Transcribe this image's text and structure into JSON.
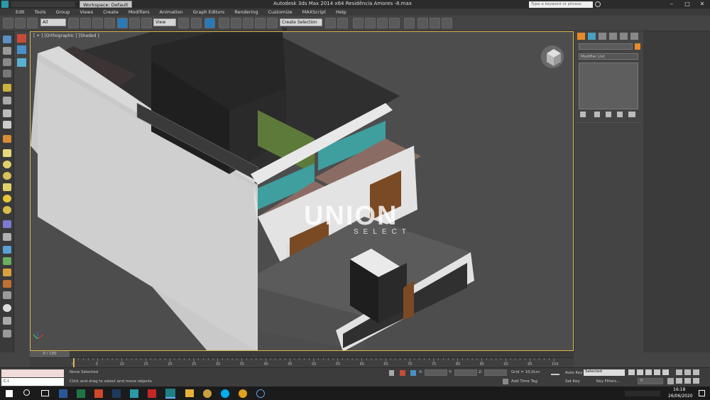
{
  "titlebar": {
    "workspace": "Workspace: Default",
    "title": "Autodesk 3ds Max  2014 x64     Residência Amores -8.max",
    "search_placeholder": "Type a keyword or phrase"
  },
  "menu": [
    "Edit",
    "Tools",
    "Group",
    "Views",
    "Create",
    "Modifiers",
    "Animation",
    "Graph Editors",
    "Rendering",
    "Customize",
    "MAXScript",
    "Help"
  ],
  "toolbar": {
    "filter": "All",
    "ref_coord": "View",
    "selection_set": "Create Selection Se"
  },
  "viewport": {
    "label": "[ + ] [Orthographic ] [Shaded ]",
    "watermark_main": "UNION",
    "watermark_sub": "SELECT"
  },
  "command_panel": {
    "modifier_list": "Modifier List",
    "accent": "#e88a2a"
  },
  "timeline": {
    "frame": "0 / 100",
    "ticks": [
      "0",
      "5",
      "10",
      "15",
      "20",
      "25",
      "30",
      "35",
      "40",
      "45",
      "50",
      "55",
      "60",
      "65",
      "70",
      "75",
      "80",
      "85",
      "90",
      "95",
      "100"
    ]
  },
  "status": {
    "selection": "None Selected",
    "prompt": "Click and drag to select and move objects",
    "x_label": "X:",
    "y_label": "Y:",
    "z_label": "Z:",
    "grid": "Grid = 10,0cm",
    "add_time_tag": "Add Time Tag",
    "auto_key": "Auto Key",
    "selected": "Selected",
    "set_key": "Set Key",
    "key_filters": "Key Filters...",
    "frame_value": "0"
  },
  "taskbar": {
    "time": "16:18",
    "date": "26/06/2020"
  }
}
